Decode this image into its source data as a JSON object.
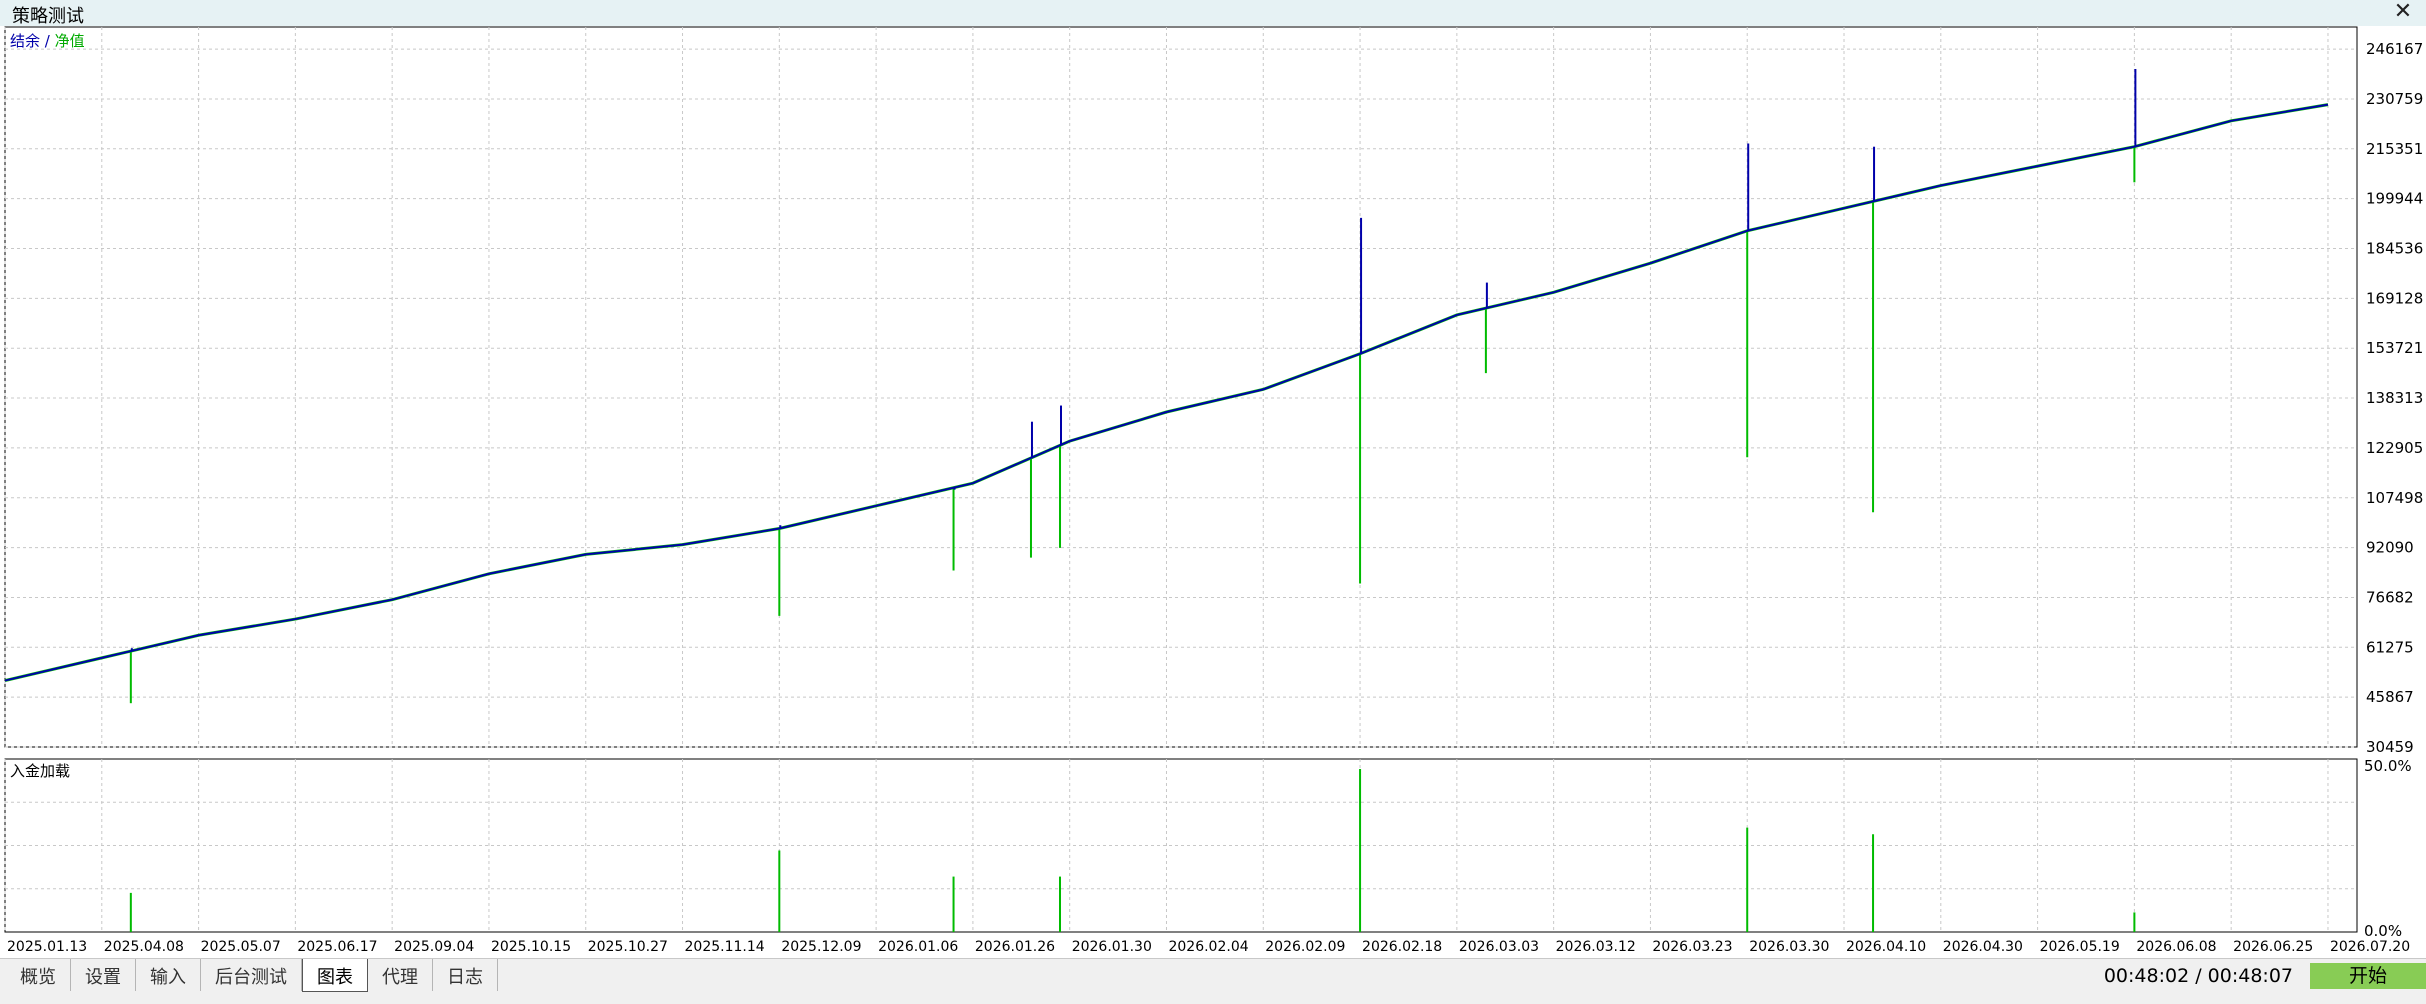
{
  "window": {
    "title": "策略测试",
    "close_glyph": "✕"
  },
  "legend": {
    "balance": "结余",
    "separator": " / ",
    "equity": "净值"
  },
  "colors": {
    "balance": "#0000aa",
    "equity": "#00bb00",
    "grid": "#c8c8c8",
    "start_button": "#88cc55"
  },
  "chart_data": [
    {
      "type": "line",
      "series": [
        {
          "name": "结余",
          "color": "#0000aa"
        },
        {
          "name": "净值",
          "color": "#00bb00"
        }
      ],
      "x": [
        "2025.01.13",
        "2025.04.08",
        "2025.05.07",
        "2025.06.17",
        "2025.09.04",
        "2025.10.15",
        "2025.10.27",
        "2025.11.14",
        "2025.12.09",
        "2026.01.06",
        "2026.01.26",
        "2026.01.30",
        "2026.02.04",
        "2026.02.09",
        "2026.02.18",
        "2026.03.03",
        "2026.03.12",
        "2026.03.23",
        "2026.03.30",
        "2026.04.10",
        "2026.04.30",
        "2026.05.19",
        "2026.06.08",
        "2026.06.25",
        "2026.07.20"
      ],
      "balance_values": [
        51000,
        58000,
        65000,
        70000,
        76000,
        84000,
        90000,
        93000,
        98000,
        105000,
        112000,
        125000,
        134000,
        141000,
        152000,
        164000,
        171000,
        180000,
        190000,
        197000,
        204000,
        210000,
        216000,
        224000,
        229000
      ],
      "y_ticks": [
        246167,
        230759,
        215351,
        199944,
        184536,
        169128,
        153721,
        138313,
        122905,
        107498,
        92090,
        76682,
        61275,
        45867,
        30459
      ],
      "ylim": [
        30459,
        253000
      ],
      "spikes": [
        {
          "i": 1.3,
          "balance_top": 61000,
          "equity_low": 44000
        },
        {
          "i": 8.0,
          "balance_top": 99000,
          "equity_low": 71000
        },
        {
          "i": 9.8,
          "balance_top": 110000,
          "equity_low": 85000
        },
        {
          "i": 10.6,
          "balance_top": 131000,
          "equity_low": 89000
        },
        {
          "i": 10.9,
          "balance_top": 136000,
          "equity_low": 92000
        },
        {
          "i": 14.0,
          "balance_top": 194000,
          "equity_low": 81000
        },
        {
          "i": 15.3,
          "balance_top": 174000,
          "equity_low": 146000
        },
        {
          "i": 18.0,
          "balance_top": 217000,
          "equity_low": 120000
        },
        {
          "i": 19.3,
          "balance_top": 216000,
          "equity_low": 103000
        },
        {
          "i": 22.0,
          "balance_top": 240000,
          "equity_low": 205000
        }
      ]
    },
    {
      "type": "bar",
      "title": "入金加载",
      "y_ticks": [
        "50.0%",
        "0.0%"
      ],
      "ylim": [
        0,
        50
      ],
      "spikes": [
        {
          "i": 1.3,
          "value": 12
        },
        {
          "i": 8.0,
          "value": 25
        },
        {
          "i": 9.8,
          "value": 17
        },
        {
          "i": 10.9,
          "value": 17
        },
        {
          "i": 14.0,
          "value": 50
        },
        {
          "i": 18.0,
          "value": 32
        },
        {
          "i": 19.3,
          "value": 30
        },
        {
          "i": 22.0,
          "value": 6
        }
      ]
    }
  ],
  "tabs": [
    "概览",
    "设置",
    "输入",
    "后台测试",
    "图表",
    "代理",
    "日志"
  ],
  "active_tab": "图表",
  "time_readout": "00:48:02 / 00:48:07",
  "start_button": "开始"
}
